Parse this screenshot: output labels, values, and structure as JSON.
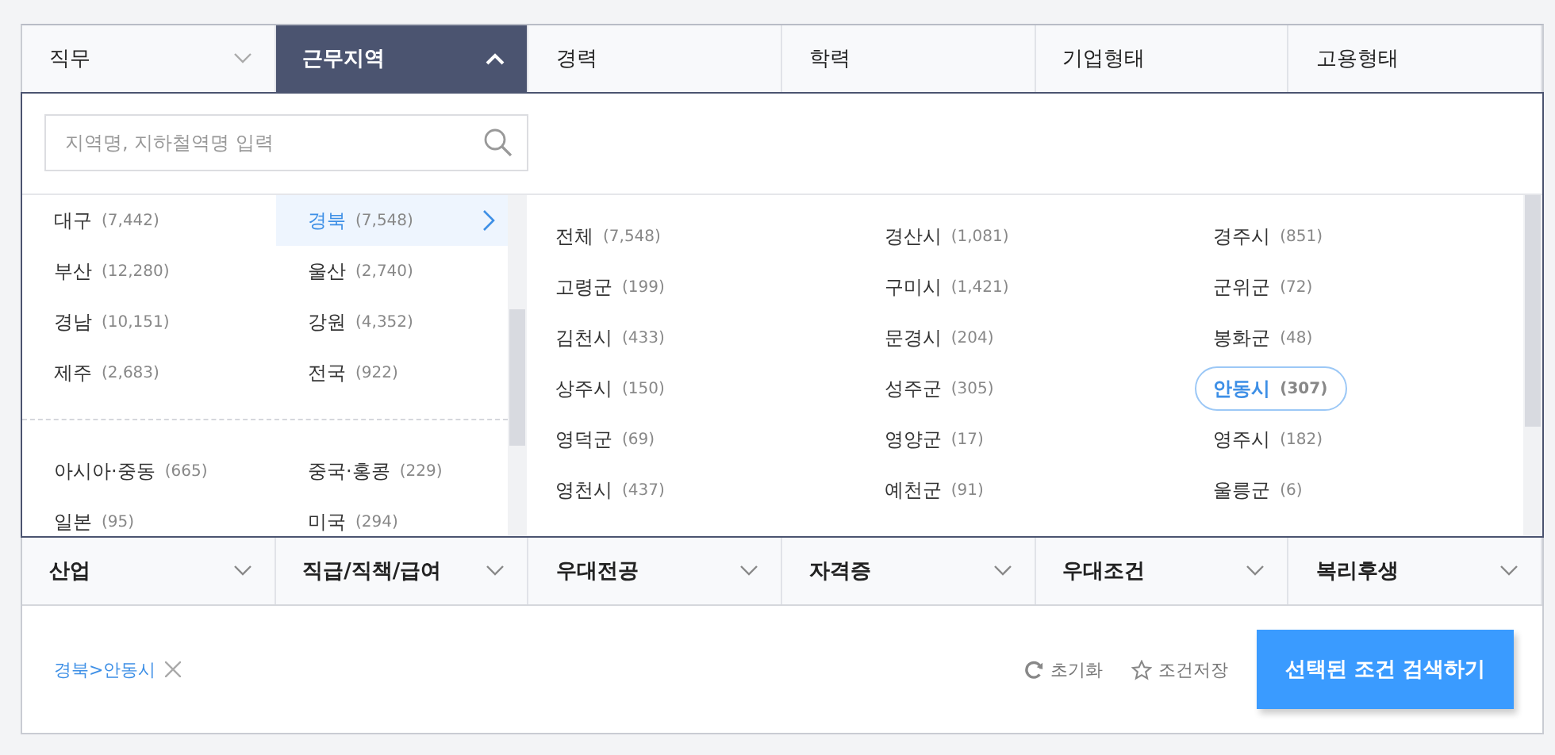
{
  "top_tabs": [
    {
      "label": "직무",
      "selected": false,
      "has_arrow": true
    },
    {
      "label": "근무지역",
      "selected": true,
      "has_arrow": true
    },
    {
      "label": "경력",
      "selected": false,
      "has_arrow": false
    },
    {
      "label": "학력",
      "selected": false,
      "has_arrow": false
    },
    {
      "label": "기업형태",
      "selected": false,
      "has_arrow": false
    },
    {
      "label": "고용형태",
      "selected": false,
      "has_arrow": false
    }
  ],
  "search": {
    "placeholder": "지역명, 지하철역명 입력"
  },
  "region_groups": [
    {
      "items": [
        {
          "name": "대구",
          "count": "(7,442)",
          "selected": false
        },
        {
          "name": "경북",
          "count": "(7,548)",
          "selected": true
        },
        {
          "name": "부산",
          "count": "(12,280)",
          "selected": false
        },
        {
          "name": "울산",
          "count": "(2,740)",
          "selected": false
        },
        {
          "name": "경남",
          "count": "(10,151)",
          "selected": false
        },
        {
          "name": "강원",
          "count": "(4,352)",
          "selected": false
        },
        {
          "name": "제주",
          "count": "(2,683)",
          "selected": false
        },
        {
          "name": "전국",
          "count": "(922)",
          "selected": false
        }
      ]
    },
    {
      "items": [
        {
          "name": "아시아·중동",
          "count": "(665)",
          "selected": false
        },
        {
          "name": "중국·홍콩",
          "count": "(229)",
          "selected": false
        },
        {
          "name": "일본",
          "count": "(95)",
          "selected": false
        },
        {
          "name": "미국",
          "count": "(294)",
          "selected": false
        }
      ]
    }
  ],
  "sub_regions": [
    {
      "name": "전체",
      "count": "(7,548)",
      "selected": false
    },
    {
      "name": "경산시",
      "count": "(1,081)",
      "selected": false
    },
    {
      "name": "경주시",
      "count": "(851)",
      "selected": false
    },
    {
      "name": "고령군",
      "count": "(199)",
      "selected": false
    },
    {
      "name": "구미시",
      "count": "(1,421)",
      "selected": false
    },
    {
      "name": "군위군",
      "count": "(72)",
      "selected": false
    },
    {
      "name": "김천시",
      "count": "(433)",
      "selected": false
    },
    {
      "name": "문경시",
      "count": "(204)",
      "selected": false
    },
    {
      "name": "봉화군",
      "count": "(48)",
      "selected": false
    },
    {
      "name": "상주시",
      "count": "(150)",
      "selected": false
    },
    {
      "name": "성주군",
      "count": "(305)",
      "selected": false
    },
    {
      "name": "안동시",
      "count": "(307)",
      "selected": true
    },
    {
      "name": "영덕군",
      "count": "(69)",
      "selected": false
    },
    {
      "name": "영양군",
      "count": "(17)",
      "selected": false
    },
    {
      "name": "영주시",
      "count": "(182)",
      "selected": false
    },
    {
      "name": "영천시",
      "count": "(437)",
      "selected": false
    },
    {
      "name": "예천군",
      "count": "(91)",
      "selected": false
    },
    {
      "name": "울릉군",
      "count": "(6)",
      "selected": false
    }
  ],
  "bottom_tabs": [
    {
      "label": "산업"
    },
    {
      "label": "직급/직책/급여"
    },
    {
      "label": "우대전공"
    },
    {
      "label": "자격증"
    },
    {
      "label": "우대조건"
    },
    {
      "label": "복리후생"
    }
  ],
  "selected_filters": [
    {
      "label": "경북>안동시"
    }
  ],
  "actions": [
    {
      "kind": "reset",
      "label": "초기화"
    },
    {
      "kind": "save",
      "label": "조건저장"
    }
  ],
  "search_button": "선택된 조건 검색하기"
}
